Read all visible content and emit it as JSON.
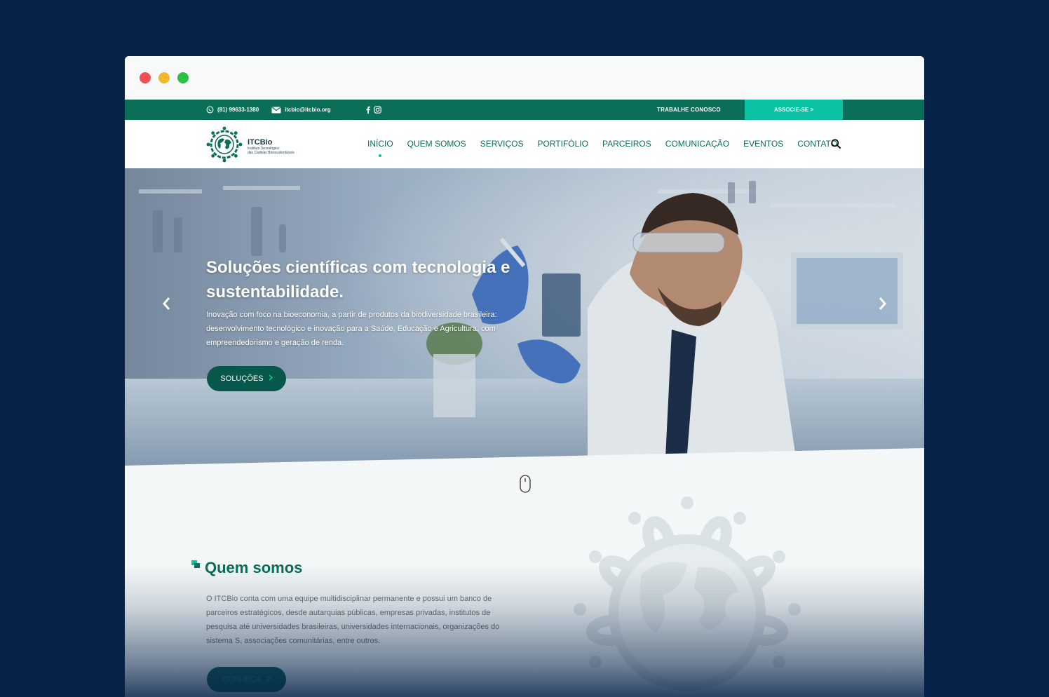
{
  "topbar": {
    "phone": "(81) 99633-1380",
    "email": "itcbio@itcbio.org",
    "work_label": "TRABALHE CONOSCO",
    "join_label": "ASSOCIE-SE >"
  },
  "logo": {
    "name": "ITCBio",
    "subtitle_line1": "Instituto Tecnológico",
    "subtitle_line2": "das Cadeias Biossustentáveis"
  },
  "nav": {
    "items": [
      {
        "label": "INÍCIO",
        "active": true
      },
      {
        "label": "QUEM SOMOS"
      },
      {
        "label": "SERVIÇOS"
      },
      {
        "label": "PORTIFÓLIO"
      },
      {
        "label": "PARCEIROS"
      },
      {
        "label": "COMUNICAÇÃO"
      },
      {
        "label": "EVENTOS"
      },
      {
        "label": "CONTATO"
      }
    ]
  },
  "hero": {
    "title": "Soluções científicas com tecnologia e sustentabilidade.",
    "text": "Inovação com foco na bioeconomia, a partir de produtos da biodiversidade brasileira: desenvolvimento tecnológico e inovação para a Saúde, Educação e Agricultura, com empreendedorismo e geração de renda.",
    "button_label": "SOLUÇÕES"
  },
  "about": {
    "title": "Quem somos",
    "text": "O ITCBio conta com uma equipe multidisciplinar permanente e possui um banco de parceiros estratégicos, desde autarquias públicas, empresas privadas, institutos de pesquisa até universidades brasileiras, universidades internacionais, organizações do sistema S, associações comunitárias, entre outros.",
    "button_label": "CONHEÇA"
  },
  "colors": {
    "background": "#07234a",
    "brand_green": "#0a6e58",
    "accent_teal": "#0bc3a3"
  },
  "icons": [
    "whatsapp-icon",
    "mail-icon",
    "facebook-icon",
    "instagram-icon",
    "search-icon",
    "chevron-left-icon",
    "chevron-right-icon",
    "mouse-scroll-icon",
    "chevron-right-small-icon"
  ]
}
